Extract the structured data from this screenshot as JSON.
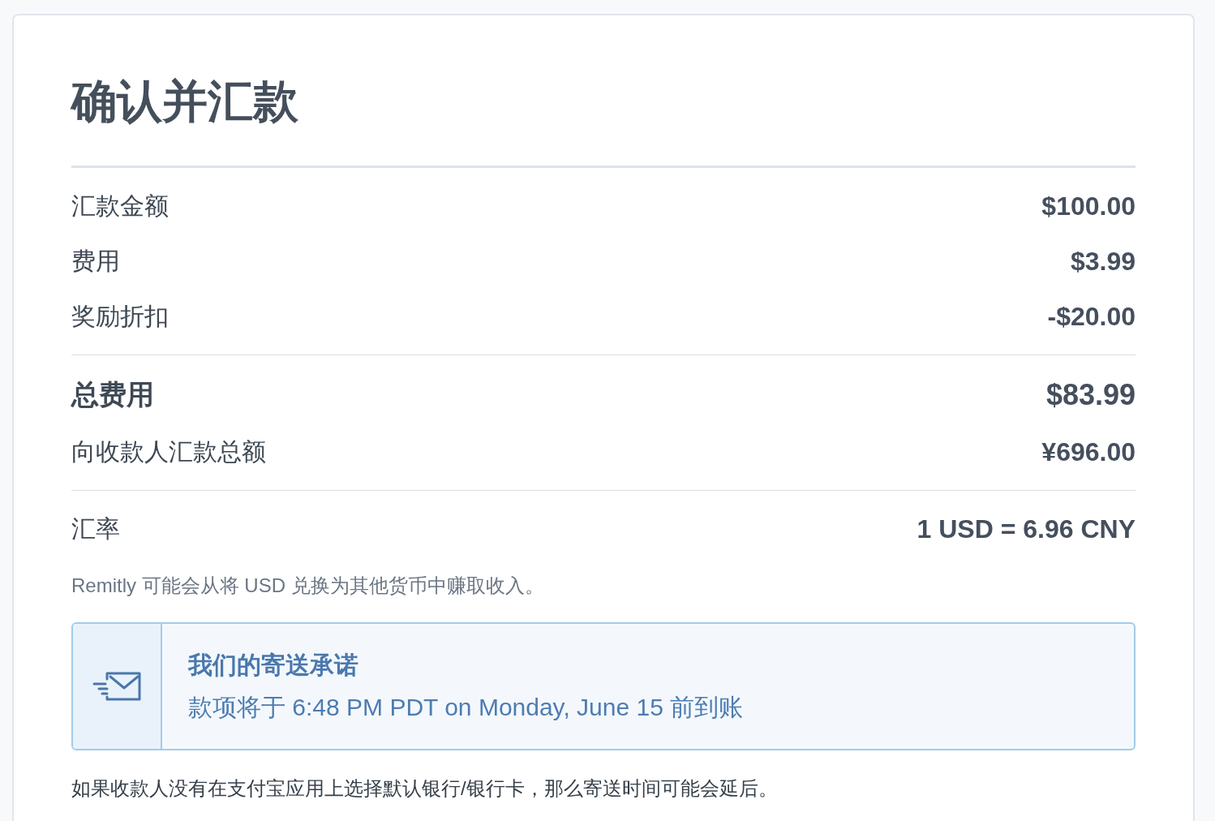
{
  "title": "确认并汇款",
  "sections": [
    {
      "rows": [
        {
          "kind": "line",
          "label": "汇款金额",
          "value": "$100.00"
        },
        {
          "kind": "line",
          "label": "费用",
          "value": "$3.99"
        },
        {
          "kind": "line",
          "label": "奖励折扣",
          "value": "-$20.00"
        }
      ]
    },
    {
      "rows": [
        {
          "kind": "total",
          "label": "总费用",
          "value": "$83.99"
        },
        {
          "kind": "line",
          "label": "向收款人汇款总额",
          "value": "¥696.00"
        }
      ]
    },
    {
      "rows": [
        {
          "kind": "line",
          "label": "汇率",
          "value": "1 USD = 6.96 CNY"
        }
      ]
    }
  ],
  "note": "Remitly 可能会从将 USD 兑换为其他货币中赚取收入。",
  "delivery_promise": {
    "title": "我们的寄送承诺",
    "message": "款项将于 6:48 PM PDT on Monday, June 15 前到账"
  },
  "footnote": "如果收款人没有在支付宝应用上选择默认银行/银行卡，那么寄送时间可能会延后。"
}
